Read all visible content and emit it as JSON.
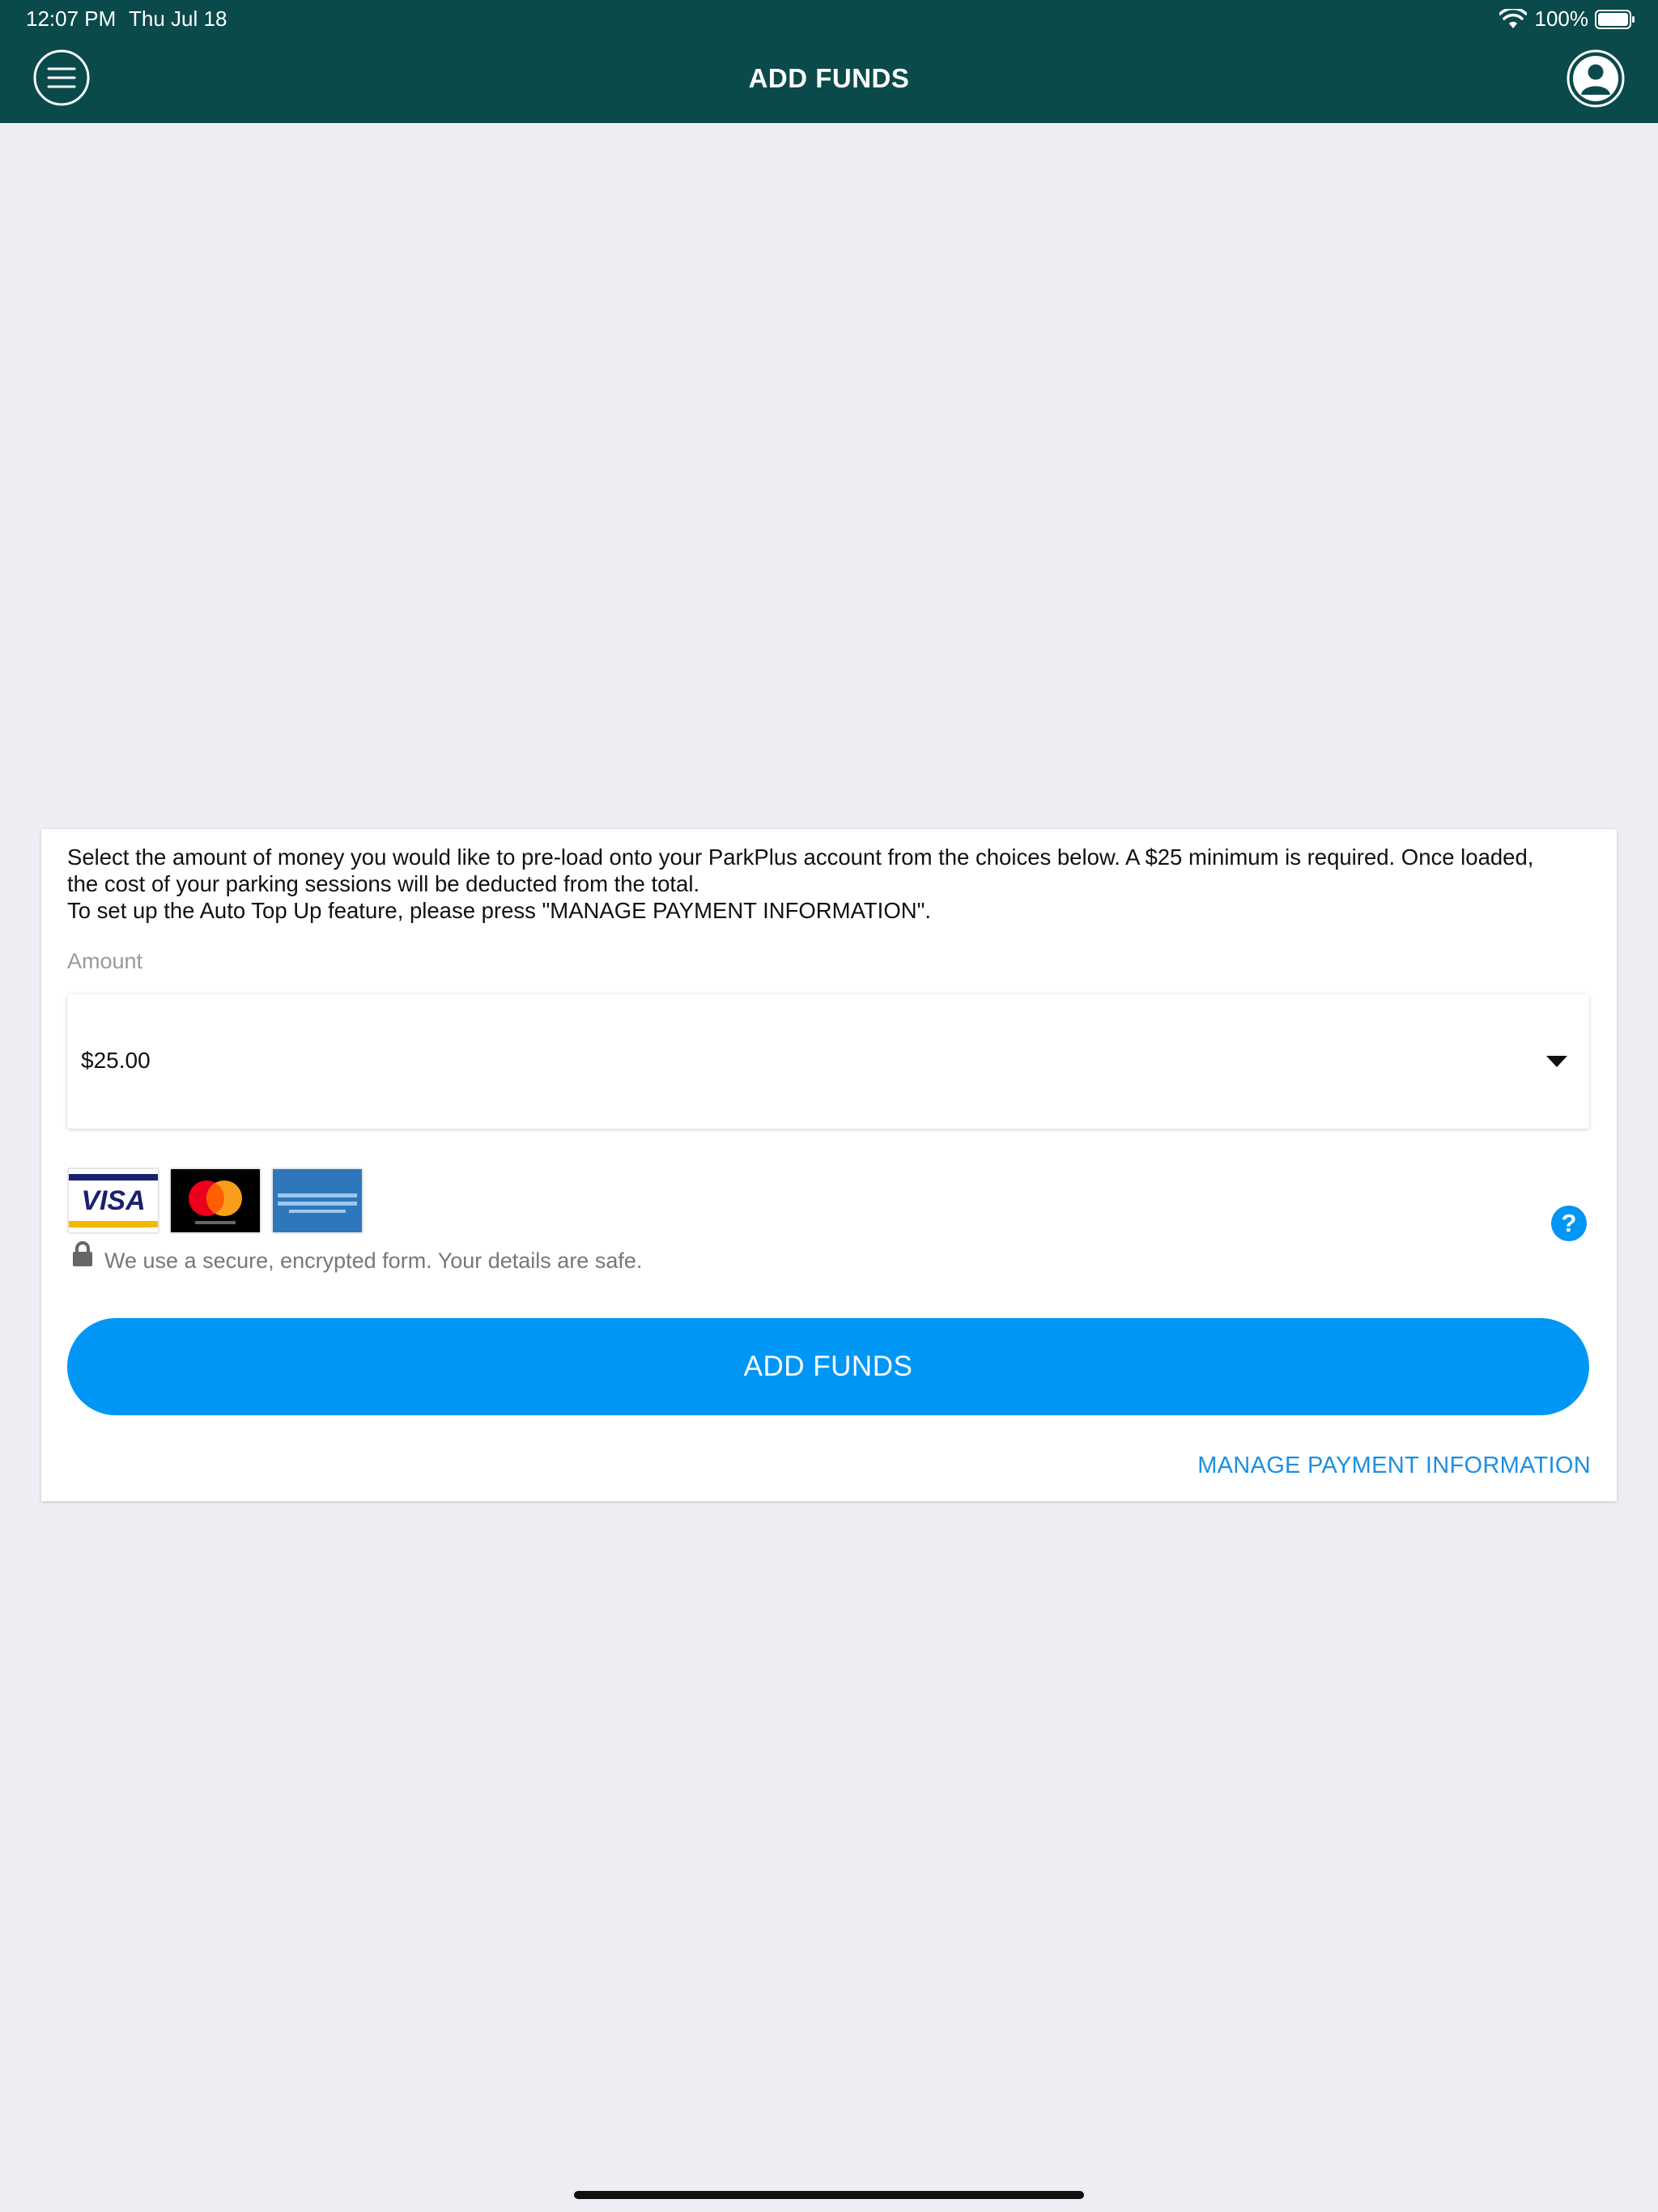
{
  "status_bar": {
    "time": "12:07 PM",
    "date": "Thu Jul 18",
    "battery": "100%"
  },
  "header": {
    "title": "ADD FUNDS",
    "menu_icon": "hamburger-menu-icon",
    "profile_icon": "user-profile-icon",
    "background": "#0b4a4a"
  },
  "form": {
    "intro_lines": [
      "Select the amount of money you would like to pre-load onto your ParkPlus account from the choices below. A $25 minimum is required. Once loaded,",
      "the cost of your parking sessions will be deducted from the total.",
      "To set up the Auto Top Up feature, please press \"MANAGE PAYMENT INFORMATION\"."
    ],
    "amount_label": "Amount",
    "amount_value": "$25.00",
    "accepted_cards": [
      "visa-logo",
      "mastercard-logo",
      "american-express-logo"
    ],
    "secure_note": "We use a secure, encrypted form. Your details are safe.",
    "add_button": "ADD FUNDS",
    "manage_link": "MANAGE PAYMENT INFORMATION",
    "accent": "#0096f5"
  }
}
